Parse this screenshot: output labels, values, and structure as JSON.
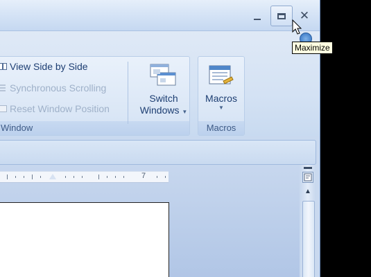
{
  "window_controls": {
    "minimize_symbol": "–",
    "close_symbol": "✕"
  },
  "ribbon": {
    "window_group": {
      "label": "Window",
      "commands": [
        {
          "label": "View Side by Side",
          "enabled": true,
          "icon": "view-side-by-side-icon"
        },
        {
          "label": "Synchronous Scrolling",
          "enabled": false,
          "icon": "synchronous-scrolling-icon"
        },
        {
          "label": "Reset Window Position",
          "enabled": false,
          "icon": "reset-window-position-icon"
        }
      ],
      "switch_windows": {
        "line1": "Switch",
        "line2": "Windows",
        "icon": "switch-windows-icon"
      }
    },
    "macros_group": {
      "label": "Macros",
      "macros_button": {
        "label": "Macros",
        "icon": "macros-icon"
      }
    }
  },
  "ruler": {
    "number": "7"
  },
  "tooltip": {
    "text": "Maximize"
  },
  "colors": {
    "ribbon_text": "#1d3e72",
    "disabled_text": "#9fb1c9",
    "group_label": "#3d5a86",
    "tooltip_bg": "#ffffe1"
  }
}
